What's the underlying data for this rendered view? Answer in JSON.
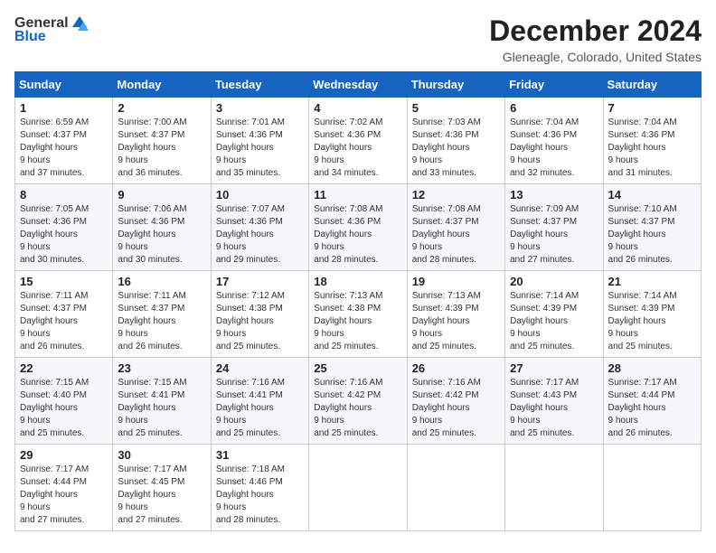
{
  "logo": {
    "general": "General",
    "blue": "Blue"
  },
  "title": "December 2024",
  "location": "Gleneagle, Colorado, United States",
  "weekdays": [
    "Sunday",
    "Monday",
    "Tuesday",
    "Wednesday",
    "Thursday",
    "Friday",
    "Saturday"
  ],
  "weeks": [
    [
      {
        "day": "1",
        "sunrise": "6:59 AM",
        "sunset": "4:37 PM",
        "daylight": "9 hours and 37 minutes."
      },
      {
        "day": "2",
        "sunrise": "7:00 AM",
        "sunset": "4:37 PM",
        "daylight": "9 hours and 36 minutes."
      },
      {
        "day": "3",
        "sunrise": "7:01 AM",
        "sunset": "4:36 PM",
        "daylight": "9 hours and 35 minutes."
      },
      {
        "day": "4",
        "sunrise": "7:02 AM",
        "sunset": "4:36 PM",
        "daylight": "9 hours and 34 minutes."
      },
      {
        "day": "5",
        "sunrise": "7:03 AM",
        "sunset": "4:36 PM",
        "daylight": "9 hours and 33 minutes."
      },
      {
        "day": "6",
        "sunrise": "7:04 AM",
        "sunset": "4:36 PM",
        "daylight": "9 hours and 32 minutes."
      },
      {
        "day": "7",
        "sunrise": "7:04 AM",
        "sunset": "4:36 PM",
        "daylight": "9 hours and 31 minutes."
      }
    ],
    [
      {
        "day": "8",
        "sunrise": "7:05 AM",
        "sunset": "4:36 PM",
        "daylight": "9 hours and 30 minutes."
      },
      {
        "day": "9",
        "sunrise": "7:06 AM",
        "sunset": "4:36 PM",
        "daylight": "9 hours and 30 minutes."
      },
      {
        "day": "10",
        "sunrise": "7:07 AM",
        "sunset": "4:36 PM",
        "daylight": "9 hours and 29 minutes."
      },
      {
        "day": "11",
        "sunrise": "7:08 AM",
        "sunset": "4:36 PM",
        "daylight": "9 hours and 28 minutes."
      },
      {
        "day": "12",
        "sunrise": "7:08 AM",
        "sunset": "4:37 PM",
        "daylight": "9 hours and 28 minutes."
      },
      {
        "day": "13",
        "sunrise": "7:09 AM",
        "sunset": "4:37 PM",
        "daylight": "9 hours and 27 minutes."
      },
      {
        "day": "14",
        "sunrise": "7:10 AM",
        "sunset": "4:37 PM",
        "daylight": "9 hours and 26 minutes."
      }
    ],
    [
      {
        "day": "15",
        "sunrise": "7:11 AM",
        "sunset": "4:37 PM",
        "daylight": "9 hours and 26 minutes."
      },
      {
        "day": "16",
        "sunrise": "7:11 AM",
        "sunset": "4:37 PM",
        "daylight": "9 hours and 26 minutes."
      },
      {
        "day": "17",
        "sunrise": "7:12 AM",
        "sunset": "4:38 PM",
        "daylight": "9 hours and 25 minutes."
      },
      {
        "day": "18",
        "sunrise": "7:13 AM",
        "sunset": "4:38 PM",
        "daylight": "9 hours and 25 minutes."
      },
      {
        "day": "19",
        "sunrise": "7:13 AM",
        "sunset": "4:39 PM",
        "daylight": "9 hours and 25 minutes."
      },
      {
        "day": "20",
        "sunrise": "7:14 AM",
        "sunset": "4:39 PM",
        "daylight": "9 hours and 25 minutes."
      },
      {
        "day": "21",
        "sunrise": "7:14 AM",
        "sunset": "4:39 PM",
        "daylight": "9 hours and 25 minutes."
      }
    ],
    [
      {
        "day": "22",
        "sunrise": "7:15 AM",
        "sunset": "4:40 PM",
        "daylight": "9 hours and 25 minutes."
      },
      {
        "day": "23",
        "sunrise": "7:15 AM",
        "sunset": "4:41 PM",
        "daylight": "9 hours and 25 minutes."
      },
      {
        "day": "24",
        "sunrise": "7:16 AM",
        "sunset": "4:41 PM",
        "daylight": "9 hours and 25 minutes."
      },
      {
        "day": "25",
        "sunrise": "7:16 AM",
        "sunset": "4:42 PM",
        "daylight": "9 hours and 25 minutes."
      },
      {
        "day": "26",
        "sunrise": "7:16 AM",
        "sunset": "4:42 PM",
        "daylight": "9 hours and 25 minutes."
      },
      {
        "day": "27",
        "sunrise": "7:17 AM",
        "sunset": "4:43 PM",
        "daylight": "9 hours and 25 minutes."
      },
      {
        "day": "28",
        "sunrise": "7:17 AM",
        "sunset": "4:44 PM",
        "daylight": "9 hours and 26 minutes."
      }
    ],
    [
      {
        "day": "29",
        "sunrise": "7:17 AM",
        "sunset": "4:44 PM",
        "daylight": "9 hours and 27 minutes."
      },
      {
        "day": "30",
        "sunrise": "7:17 AM",
        "sunset": "4:45 PM",
        "daylight": "9 hours and 27 minutes."
      },
      {
        "day": "31",
        "sunrise": "7:18 AM",
        "sunset": "4:46 PM",
        "daylight": "9 hours and 28 minutes."
      },
      null,
      null,
      null,
      null
    ]
  ],
  "labels": {
    "sunrise": "Sunrise:",
    "sunset": "Sunset:",
    "daylight": "Daylight hours"
  }
}
